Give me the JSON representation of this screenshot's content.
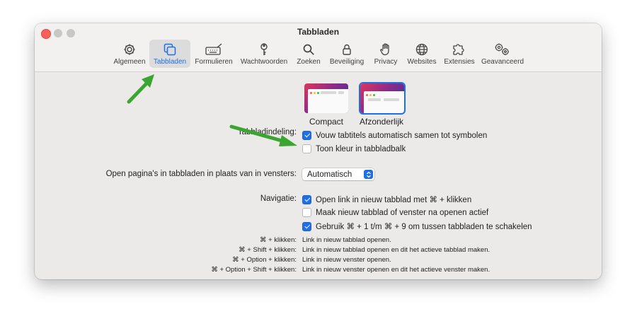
{
  "window": {
    "title": "Tabbladen"
  },
  "tabs": [
    {
      "label": "Algemeen",
      "icon": "gear-icon",
      "active": false
    },
    {
      "label": "Tabbladen",
      "icon": "tabs-icon",
      "active": true
    },
    {
      "label": "Formulieren",
      "icon": "keyboard-pen-icon",
      "active": false
    },
    {
      "label": "Wachtwoorden",
      "icon": "key-icon",
      "active": false
    },
    {
      "label": "Zoeken",
      "icon": "magnifier-icon",
      "active": false
    },
    {
      "label": "Beveiliging",
      "icon": "lock-icon",
      "active": false
    },
    {
      "label": "Privacy",
      "icon": "hand-icon",
      "active": false
    },
    {
      "label": "Websites",
      "icon": "globe-icon",
      "active": false
    },
    {
      "label": "Extensies",
      "icon": "puzzle-icon",
      "active": false
    },
    {
      "label": "Geavanceerd",
      "icon": "gears-icon",
      "active": false
    }
  ],
  "layout_section": {
    "label": "Tabbladindeling:",
    "options": [
      {
        "label": "Compact",
        "selected": false
      },
      {
        "label": "Afzonderlijk",
        "selected": true
      }
    ],
    "checkboxes": [
      {
        "label": "Vouw tabtitels automatisch samen tot symbolen",
        "checked": true
      },
      {
        "label": "Toon kleur in tabbladbalk",
        "checked": false
      }
    ]
  },
  "open_pages": {
    "label": "Open pagina's in tabbladen in plaats van in vensters:",
    "value": "Automatisch"
  },
  "navigation": {
    "label": "Navigatie:",
    "checkboxes": [
      {
        "label": "Open link in nieuw tabblad met ⌘ + klikken",
        "checked": true
      },
      {
        "label": "Maak nieuw tabblad of venster na openen actief",
        "checked": false
      },
      {
        "label": "Gebruik ⌘ + 1 t/m ⌘ + 9 om tussen tabbladen te schakelen",
        "checked": true
      }
    ]
  },
  "shortcuts": [
    {
      "keys": "⌘ + klikken:",
      "desc": "Link in nieuw tabblad openen."
    },
    {
      "keys": "⌘ + Shift + klikken:",
      "desc": "Link in nieuw tabblad openen en dit het actieve tabblad maken."
    },
    {
      "keys": "⌘ + Option + klikken:",
      "desc": "Link in nieuw venster openen."
    },
    {
      "keys": "⌘ + Option + Shift + klikken:",
      "desc": "Link in nieuw venster openen en dit het actieve venster maken."
    }
  ],
  "help_button": "?",
  "colors": {
    "accent": "#1f6fe6",
    "arrow": "#3aa52f",
    "window_bg": "#eceae8"
  }
}
